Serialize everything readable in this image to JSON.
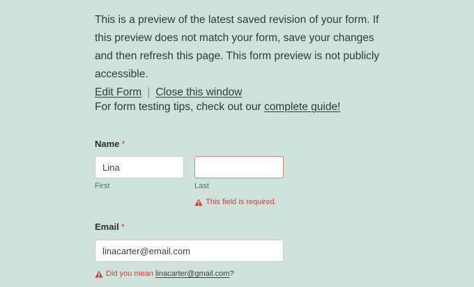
{
  "intro": {
    "text": "This is a preview of the latest saved revision of your form. If this preview does not match your form, save your changes and then refresh this page. This form preview is not publicly accessible.",
    "edit_link": "Edit Form",
    "separator": "|",
    "close_link": "Close this window"
  },
  "tips": {
    "text": "For form testing tips, check out our ",
    "link": "complete guide!"
  },
  "name_field": {
    "label": "Name",
    "required_mark": "*",
    "first": {
      "value": "Lina",
      "sublabel": "First"
    },
    "last": {
      "value": "",
      "sublabel": "Last",
      "error": "This field is required.",
      "error_icon": "warning-icon"
    }
  },
  "email_field": {
    "label": "Email",
    "required_mark": "*",
    "value": "linacarter@email.com",
    "suggestion_prefix": "Did you mean ",
    "suggestion_link": "linacarter@gmail.com",
    "suggestion_suffix": "?",
    "suggestion_icon": "warning-icon"
  },
  "colors": {
    "background": "#cfe3dc",
    "error": "#d43b3b"
  }
}
